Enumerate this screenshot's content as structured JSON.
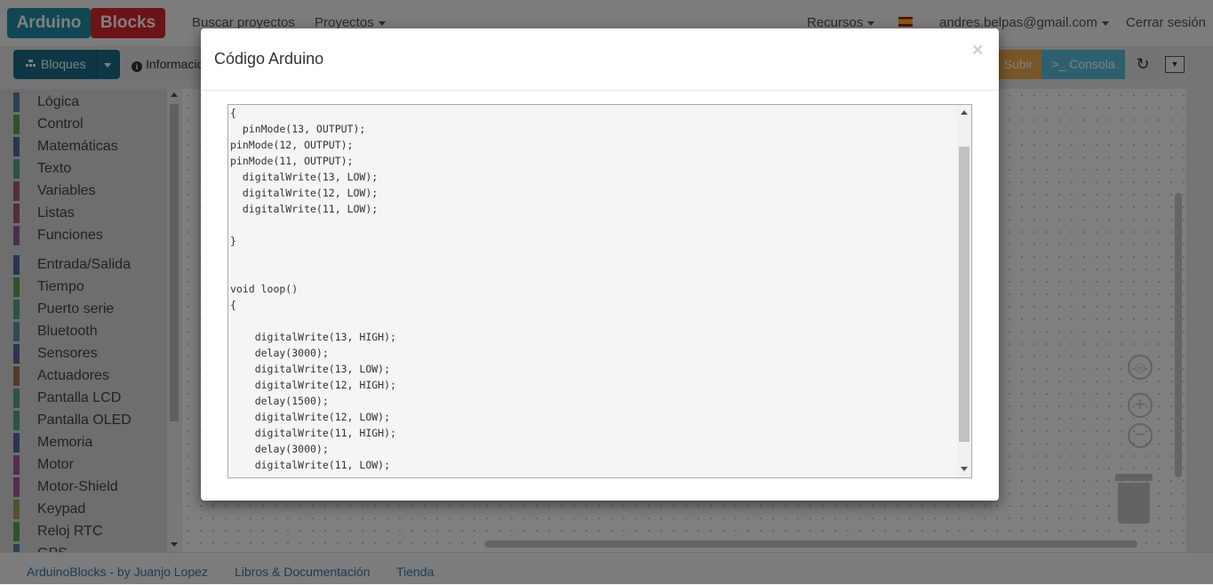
{
  "navbar": {
    "logo_left": "Arduino",
    "logo_right": "Blocks",
    "search_projects": "Buscar proyectos",
    "projects": "Proyectos",
    "resources": "Recursos",
    "user_email": "andres.belpas@gmail.com",
    "logout": "Cerrar sesión"
  },
  "toolbar": {
    "blocks_label": "Bloques",
    "info_label": "Informacio",
    "upload_label": "Subir",
    "console_label": ">_ Consola",
    "refresh_icon": "↻",
    "dropdown_icon": "▼"
  },
  "sidebar": {
    "categories": [
      {
        "name": "Lógica",
        "color": "#5b80a5"
      },
      {
        "name": "Control",
        "color": "#5ba55b"
      },
      {
        "name": "Matemáticas",
        "color": "#5b67a5"
      },
      {
        "name": "Texto",
        "color": "#5ba58c"
      },
      {
        "name": "Variables",
        "color": "#a55b80"
      },
      {
        "name": "Listas",
        "color": "#a5577f"
      },
      {
        "name": "Funciones",
        "color": "#995ba5"
      },
      {
        "name": "Entrada/Salida",
        "color": "#5b67a5"
      },
      {
        "name": "Tiempo",
        "color": "#5ba55b"
      },
      {
        "name": "Puerto serie",
        "color": "#5ba58c"
      },
      {
        "name": "Bluetooth",
        "color": "#5b99a5"
      },
      {
        "name": "Sensores",
        "color": "#5b67a5"
      },
      {
        "name": "Actuadores",
        "color": "#a5745b"
      },
      {
        "name": "Pantalla LCD",
        "color": "#5ba58c"
      },
      {
        "name": "Pantalla OLED",
        "color": "#5ba58c"
      },
      {
        "name": "Memoria",
        "color": "#5b67a5"
      },
      {
        "name": "Motor",
        "color": "#a55b99"
      },
      {
        "name": "Motor-Shield",
        "color": "#a55b99"
      },
      {
        "name": "Keypad",
        "color": "#a5a55b"
      },
      {
        "name": "Reloj RTC",
        "color": "#5ba55b"
      },
      {
        "name": "GPS",
        "color": "#5b80a5"
      }
    ]
  },
  "modal": {
    "title": "Código Arduino",
    "close": "×",
    "code": "{\n  pinMode(13, OUTPUT);\npinMode(12, OUTPUT);\npinMode(11, OUTPUT);\n  digitalWrite(13, LOW);\n  digitalWrite(12, LOW);\n  digitalWrite(11, LOW);\n\n}\n\n\nvoid loop()\n{\n\n    digitalWrite(13, HIGH);\n    delay(3000);\n    digitalWrite(13, LOW);\n    digitalWrite(12, HIGH);\n    delay(1500);\n    digitalWrite(12, LOW);\n    digitalWrite(11, HIGH);\n    delay(3000);\n    digitalWrite(11, LOW);"
  },
  "workspace": {
    "zoom_in": "+",
    "zoom_out": "−"
  },
  "footer": {
    "credit": "ArduinoBlocks - by Juanjo Lopez",
    "books": "Libros & Documentación",
    "store": "Tienda"
  }
}
